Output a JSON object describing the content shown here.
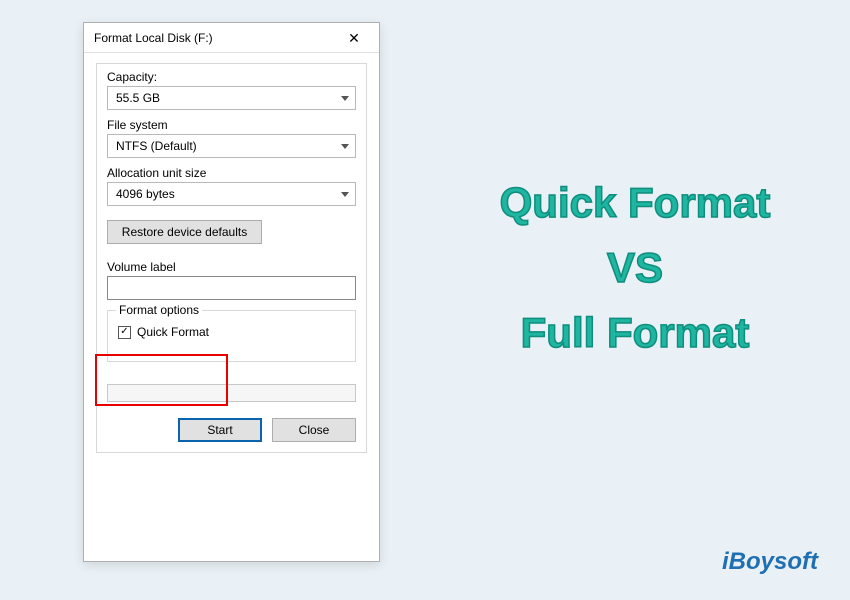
{
  "dialog": {
    "title": "Format Local Disk (F:)",
    "group": {
      "capacity_label": "Capacity:",
      "capacity_value": "55.5 GB",
      "filesystem_label": "File system",
      "filesystem_value": "NTFS (Default)",
      "alloc_label": "Allocation unit size",
      "alloc_value": "4096 bytes",
      "restore_label": "Restore device defaults",
      "volume_label": "Volume label",
      "volume_value": "",
      "format_options_legend": "Format options",
      "quick_format_label": "Quick Format",
      "quick_format_checked": "✓"
    },
    "buttons": {
      "start": "Start",
      "close": "Close"
    }
  },
  "headline": {
    "line1": "Quick Format",
    "line2": "VS",
    "line3": "Full Format"
  },
  "brand": "iBoysoft"
}
